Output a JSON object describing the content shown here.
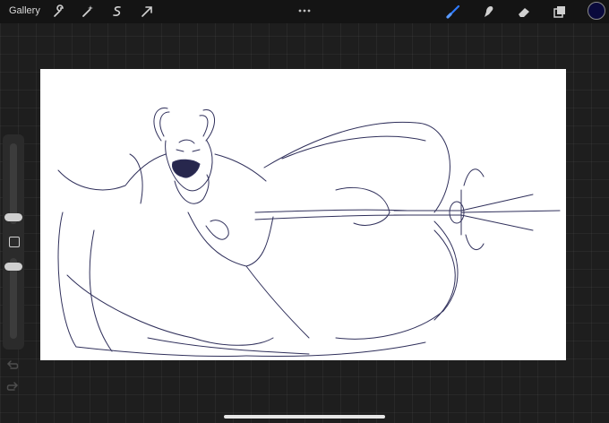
{
  "topbar": {
    "gallery_label": "Gallery",
    "actions_icon": "wrench-icon",
    "adjustments_icon": "magic-wand-icon",
    "selection_icon": "selection-s-icon",
    "transform_icon": "arrow-cursor-icon",
    "more_icon": "more-dots-icon",
    "brush_icon": "brush-icon",
    "smudge_icon": "smudge-icon",
    "eraser_icon": "eraser-icon",
    "layers_icon": "layers-icon",
    "active_color": "#0a0a3c",
    "brush_active_color": "#2f7bff"
  },
  "sidebar": {
    "brush_size_level": 0.35,
    "opacity_level": 0.55,
    "modify_icon": "square-icon",
    "undo_icon": "undo-icon",
    "redo_icon": "redo-icon"
  },
  "canvas": {
    "content": "sketch-drawing",
    "stroke_color": "#1a1a4a"
  }
}
